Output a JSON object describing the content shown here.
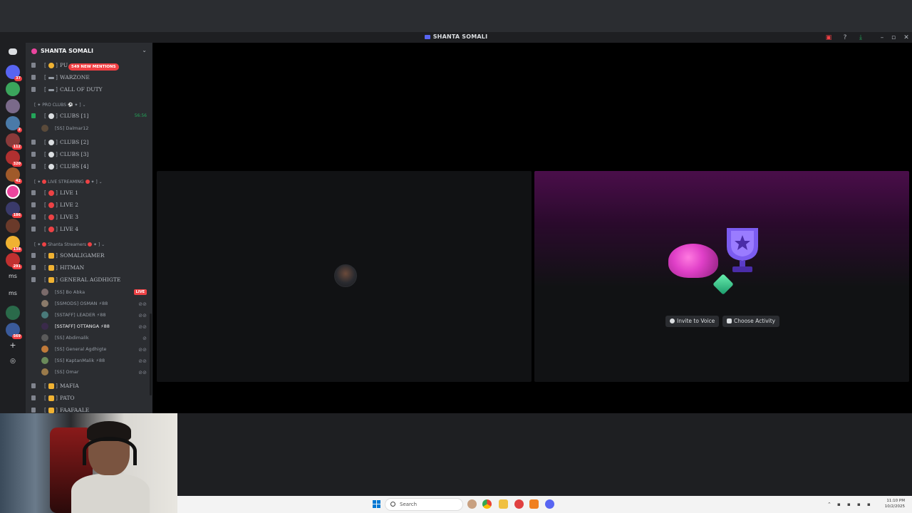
{
  "window": {
    "title": "SHANTA SOMALI"
  },
  "server": {
    "name": "SHANTA SOMALI",
    "mention_pill": "549 NEW MENTIONS"
  },
  "guild_badges": [
    "37",
    "2",
    "112",
    "320",
    "42",
    "186",
    "138",
    "291",
    "569"
  ],
  "guild_labels": {
    "ms": "ms"
  },
  "channels_top": [
    {
      "name": "PU",
      "emoji_color": "#f0b232"
    },
    {
      "name": "WARZONE",
      "emoji_color": "#949ba4"
    },
    {
      "name": "CALL OF DUTY",
      "emoji_color": "#949ba4"
    }
  ],
  "pro_clubs": {
    "category": "PRO CLUBS",
    "channels": [
      {
        "name": "CLUBS",
        "number": "1",
        "time": "56:56"
      },
      {
        "name": "CLUBS",
        "number": "2"
      },
      {
        "name": "CLUBS",
        "number": "3"
      },
      {
        "name": "CLUBS",
        "number": "4"
      }
    ],
    "member": "[SS] Dalmar12"
  },
  "live_streaming": {
    "category": "LIVE STREAMING",
    "channels": [
      "LIVE 1",
      "LIVE 2",
      "LIVE 3",
      "LIVE 4"
    ]
  },
  "streamers": {
    "category": "Shanta Streamers",
    "channels": [
      "SOMALIGAMER",
      "HITMAN",
      "GENERAL AGDHIGTE"
    ],
    "members": [
      {
        "name": "[SS] Bo Abka",
        "live": "LIVE"
      },
      {
        "name": "[SSMODS] OSMAN",
        "boost": "88"
      },
      {
        "name": "[SSTAFF] LEADER",
        "boost": "88"
      },
      {
        "name": "[SSTAFF] OTTANGA",
        "boost": "88",
        "active": true
      },
      {
        "name": "[SS] Abdimalik"
      },
      {
        "name": "[SS] General Agdhigte"
      },
      {
        "name": "[SS] KaptanMalik",
        "boost": "88"
      },
      {
        "name": "[SS] Omar"
      }
    ],
    "after_channels": [
      "MAFIA",
      "PATO",
      "FAAFAALE"
    ]
  },
  "stage": {
    "invite_button": "Invite to Voice",
    "activity_button": "Choose Activity"
  },
  "taskbar": {
    "search_placeholder": "Search",
    "clock_time": "11:10 PM",
    "clock_date": "10/2/2025"
  },
  "colors": {
    "accent": "#5865f2",
    "danger": "#f23f43",
    "online": "#23a559",
    "gradient_top": "#4a0e4a"
  }
}
